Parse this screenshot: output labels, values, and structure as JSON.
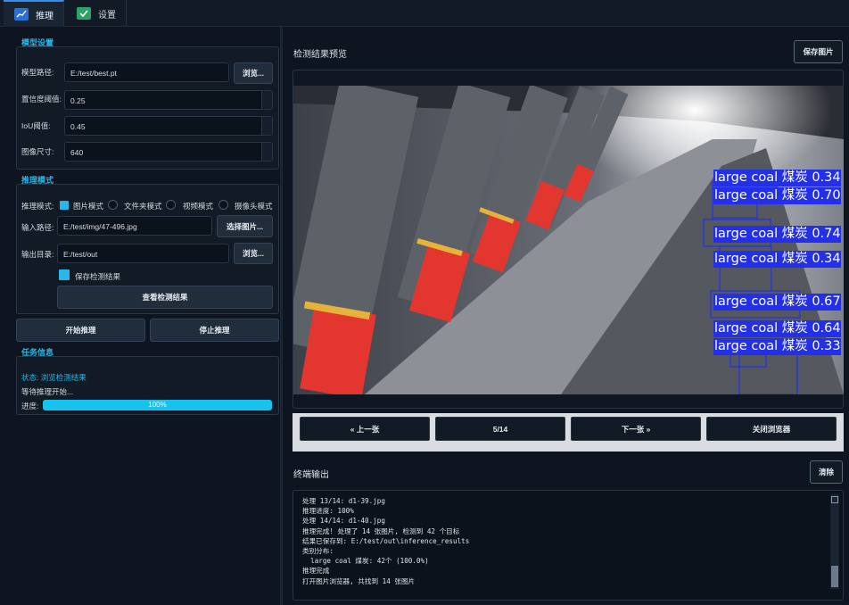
{
  "tabs": [
    {
      "label": "推理",
      "icon": "chart-icon"
    },
    {
      "label": "设置",
      "icon": "check-icon"
    }
  ],
  "model_settings": {
    "title": "模型设置",
    "model_path_label": "模型路径:",
    "model_path_value": "E:/test/best.pt",
    "browse_label": "浏览...",
    "conf_label": "置信度阈值:",
    "conf_value": "0.25",
    "iou_label": "IoU阈值:",
    "iou_value": "0.45",
    "imgsz_label": "图像尺寸:",
    "imgsz_value": "640"
  },
  "infer_mode": {
    "title": "推理模式",
    "mode_label": "推理模式:",
    "modes": [
      "图片模式",
      "文件夹模式",
      "视频模式",
      "摄像头模式"
    ],
    "selected_mode": "图片模式",
    "input_label": "输入路径:",
    "input_value": "E:/test/img/47-496.jpg",
    "select_image_label": "选择图片...",
    "output_label": "输出目录:",
    "output_value": "E:/test/out",
    "browse_label": "浏览...",
    "save_results_label": "保存检测结果",
    "save_results_checked": true,
    "view_results_label": "查看检测结果"
  },
  "actions": {
    "start_label": "开始推理",
    "stop_label": "停止推理"
  },
  "task_info": {
    "title": "任务信息",
    "status_text": "状态: 浏览检测结果",
    "waiting_text": "等待推理开始...",
    "progress_label": "进度:",
    "progress_value": 100,
    "progress_text": "100%"
  },
  "preview": {
    "title": "检测结果预览",
    "save_image_label": "保存图片",
    "detections": [
      {
        "label": "large coal 煤炭 0.34"
      },
      {
        "label": "large coal 煤炭 0.70"
      },
      {
        "label": "large coal 煤炭 0.74"
      },
      {
        "label": "large coal 煤炭 0.34"
      },
      {
        "label": "large coal 煤炭 0.67"
      },
      {
        "label": "large coal 煤炭 0.64"
      },
      {
        "label": "large coal 煤炭 0.33"
      }
    ],
    "prev_label": "« 上一张",
    "page_indicator": "5/14",
    "next_label": "下一张 »",
    "close_browser_label": "关闭浏览器"
  },
  "terminal": {
    "title": "终端输出",
    "clear_label": "清除",
    "lines": [
      "处理 13/14: d1-39.jpg",
      "推理进度: 100%",
      "处理 14/14: d1-40.jpg",
      "推理完成! 处理了 14 张图片, 检测到 42 个目标",
      "结果已保存到: E:/test/out\\inference_results",
      "类别分布:",
      "  large coal 煤炭: 42个 (100.0%)",
      "推理完成",
      "打开图片浏览器, 共找到 14 张图片"
    ]
  },
  "colors": {
    "accent": "#26b7e8",
    "progress": "#17c3ee",
    "detection_box": "#2330e8",
    "background": "#0f1520"
  }
}
